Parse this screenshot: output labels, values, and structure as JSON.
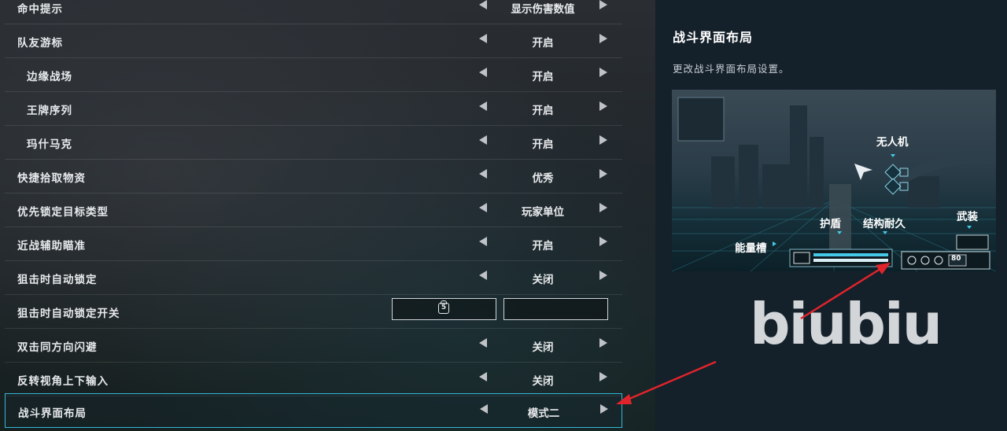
{
  "settings": {
    "rows": [
      {
        "label": "命中提示",
        "value": "显示伤害数值"
      },
      {
        "label": "队友游标",
        "value": "开启"
      },
      {
        "label": "边缘战场",
        "value": "开启"
      },
      {
        "label": "王牌序列",
        "value": "开启"
      },
      {
        "label": "玛什马克",
        "value": "开启"
      },
      {
        "label": "快捷拾取物资",
        "value": "优秀"
      },
      {
        "label": "优先锁定目标类型",
        "value": "玩家单位"
      },
      {
        "label": "近战辅助瞄准",
        "value": "开启"
      },
      {
        "label": "狙击时自动锁定",
        "value": "关闭"
      },
      {
        "label": "狙击时自动锁定开关",
        "key": "5"
      },
      {
        "label": "双击同方向闪避",
        "value": "关闭"
      },
      {
        "label": "反转视角上下输入",
        "value": "关闭"
      },
      {
        "label": "战斗界面布局",
        "value": "模式二"
      }
    ]
  },
  "detail": {
    "title": "战斗界面布局",
    "description": "更改战斗界面布局设置。",
    "preview_labels": {
      "drone": "无人机",
      "armor": "武装",
      "shield": "护盾",
      "hull": "结构耐久",
      "energy": "能量槽",
      "ammo": "80"
    }
  },
  "watermark": "biubiu",
  "colors": {
    "accent": "#36b6d8",
    "annotation_arrow": "#e0242b"
  }
}
